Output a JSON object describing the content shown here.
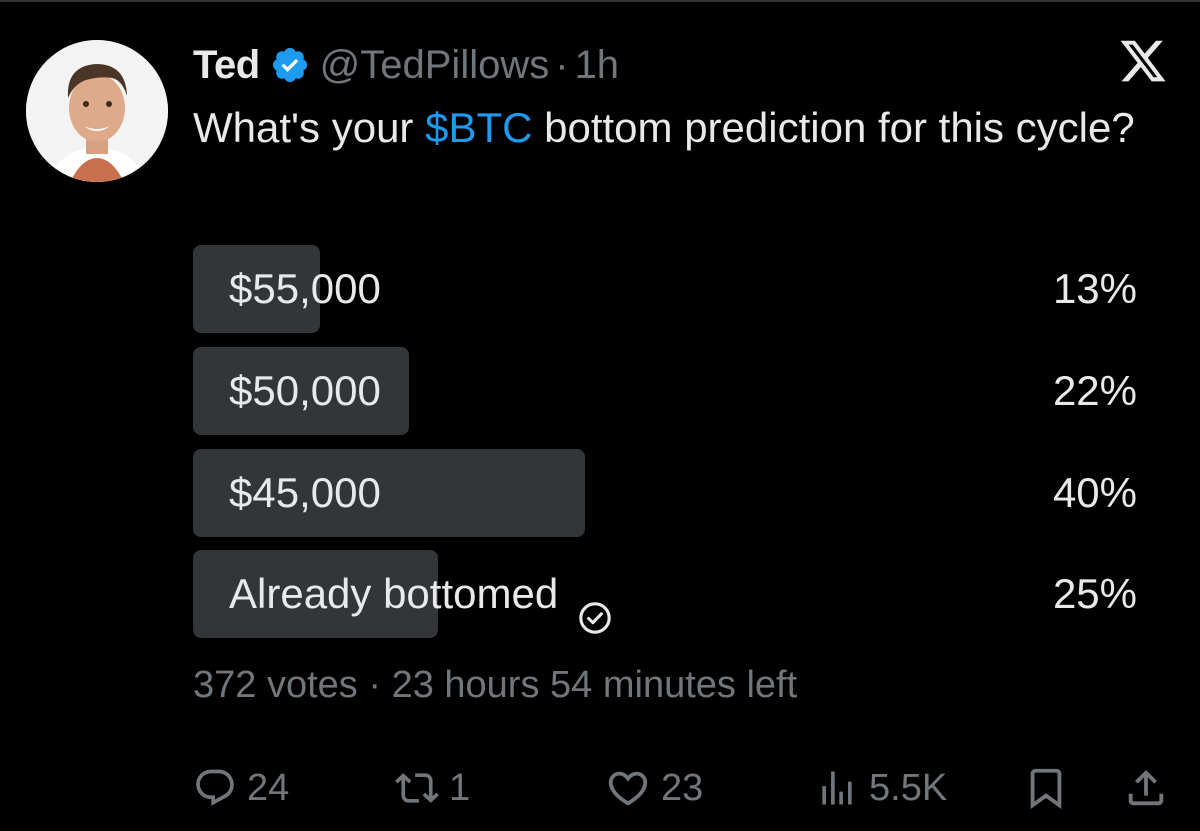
{
  "tweet": {
    "author_name": "Ted",
    "handle": "@TedPillows",
    "separator": "·",
    "time": "1h",
    "text_before": "What's your ",
    "cashtag": "$BTC",
    "text_after": " bottom prediction for this cycle?"
  },
  "poll": {
    "options": [
      {
        "label": "$55,000",
        "percent_text": "13%",
        "percent": 13,
        "selected": false
      },
      {
        "label": "$50,000",
        "percent_text": "22%",
        "percent": 22,
        "selected": false
      },
      {
        "label": "$45,000",
        "percent_text": "40%",
        "percent": 40,
        "selected": false
      },
      {
        "label": "Already bottomed",
        "percent_text": "25%",
        "percent": 25,
        "selected": true
      }
    ],
    "votes": "372 votes",
    "separator": "·",
    "time_left": "23 hours 54 minutes left"
  },
  "actions": {
    "replies": "24",
    "reposts": "1",
    "likes": "23",
    "views": "5.5K"
  },
  "icons": {
    "verified": "verified-badge-icon",
    "platform": "x-logo-icon",
    "selected_option": "check-circle-icon",
    "reply": "reply-icon",
    "repost": "repost-icon",
    "like": "heart-icon",
    "views": "views-icon",
    "bookmark": "bookmark-icon",
    "share": "share-icon"
  },
  "colors": {
    "background": "#000000",
    "text_primary": "#e7e9ea",
    "text_secondary": "#71767b",
    "accent": "#1d9bf0",
    "poll_bar": "#333639"
  }
}
